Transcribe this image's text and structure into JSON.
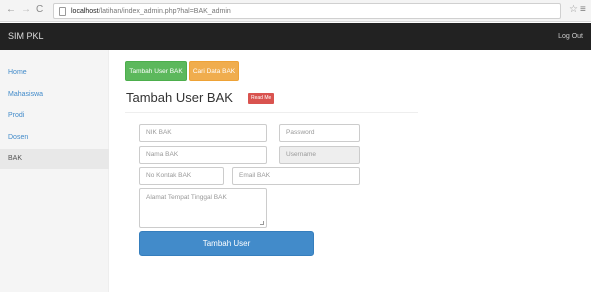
{
  "browser": {
    "url_host": "localhost",
    "url_path": "/latihan/index_admin.php?hal=BAK_admin",
    "icons": [
      "back-icon",
      "forward-icon",
      "reload-icon",
      "page-icon",
      "star-icon",
      "menu-icon"
    ]
  },
  "navbar": {
    "brand": "SIM PKL",
    "logout": "Log Out"
  },
  "sidebar": {
    "items": [
      {
        "label": "Home",
        "active": false
      },
      {
        "label": "Mahasiswa",
        "active": false
      },
      {
        "label": "Prodi",
        "active": false
      },
      {
        "label": "Dosen",
        "active": false
      },
      {
        "label": "BAK",
        "active": true
      }
    ]
  },
  "main": {
    "tabs": {
      "add_user": "Tambah User BAK",
      "search": "Cari Data BAK"
    },
    "title": "Tambah User BAK",
    "badge": "Read Me",
    "form": {
      "nik_placeholder": "NIK BAK",
      "password_placeholder": "Password",
      "nama_placeholder": "Nama BAK",
      "username_placeholder": "Username",
      "kontak_placeholder": "No Kontak BAK",
      "email_placeholder": "Email BAK",
      "alamat_placeholder": "Alamat Tempat Tinggal BAK",
      "submit_label": "Tambah User"
    }
  },
  "colors": {
    "navbar": "#222222",
    "success": "#5cb85c",
    "warning": "#f0ad4e",
    "danger": "#d9534f",
    "primary": "#428bca"
  }
}
